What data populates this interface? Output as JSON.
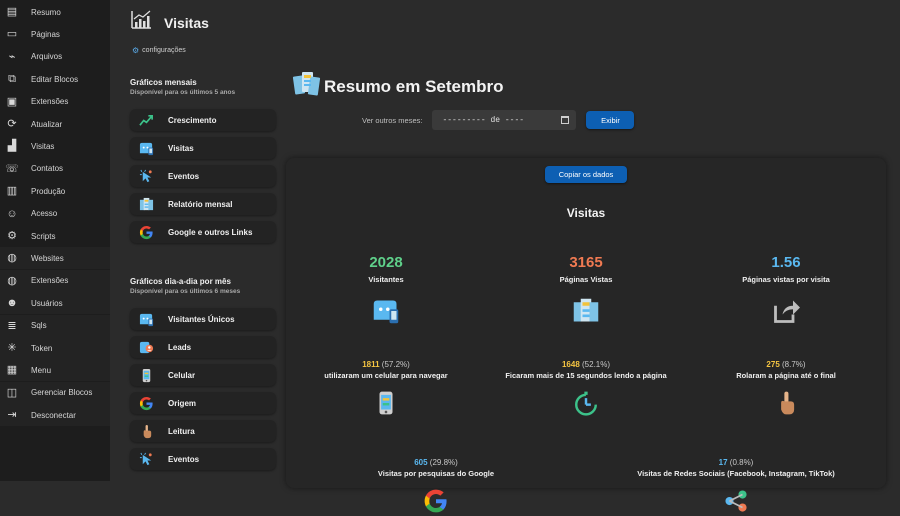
{
  "sidebar": {
    "items": [
      {
        "label": "Resumo",
        "icon": "newspaper-icon",
        "glyph": "▤"
      },
      {
        "label": "Páginas",
        "icon": "pages-icon",
        "glyph": "▭"
      },
      {
        "label": "Arquivos",
        "icon": "paperclip-icon",
        "glyph": "⌁"
      },
      {
        "label": "Editar Blocos",
        "icon": "blocks-icon",
        "glyph": "⧉"
      },
      {
        "label": "Extensões",
        "icon": "window-icon",
        "glyph": "▣"
      },
      {
        "label": "Atualizar",
        "icon": "update-icon",
        "glyph": "⟳"
      },
      {
        "label": "Visitas",
        "icon": "chart-icon",
        "glyph": "▟"
      },
      {
        "label": "Contatos",
        "icon": "contacts-icon",
        "glyph": "☏"
      },
      {
        "label": "Produção",
        "icon": "presentation-icon",
        "glyph": "▥"
      },
      {
        "label": "Acesso",
        "icon": "users-icon",
        "glyph": "☺"
      },
      {
        "label": "Scripts",
        "icon": "scripts-icon",
        "glyph": "⚙"
      },
      {
        "label": "Websites",
        "icon": "globe-icon",
        "glyph": "◍"
      },
      {
        "label": "Extensões",
        "icon": "globe-extensions-icon",
        "glyph": "◍"
      },
      {
        "label": "Usuários",
        "icon": "user-gear-icon",
        "glyph": "☻"
      },
      {
        "label": "Sqls",
        "icon": "database-icon",
        "glyph": "≣"
      },
      {
        "label": "Token",
        "icon": "network-icon",
        "glyph": "✳"
      },
      {
        "label": "Menu",
        "icon": "grid-icon",
        "glyph": "▦"
      },
      {
        "label": "Gerenciar Blocos",
        "icon": "manage-blocks-icon",
        "glyph": "◫"
      },
      {
        "label": "Desconectar",
        "icon": "logout-icon",
        "glyph": "⇥"
      }
    ]
  },
  "header": {
    "title": "Visitas",
    "config_label": "configurações"
  },
  "monthly": {
    "title": "Gráficos mensais",
    "subtitle": "Disponível para os últimos 5 anos",
    "buttons": [
      {
        "label": "Crescimento",
        "icon": "trend-icon"
      },
      {
        "label": "Visitas",
        "icon": "visitor-icon"
      },
      {
        "label": "Eventos",
        "icon": "cursor-events-icon"
      },
      {
        "label": "Relatório mensal",
        "icon": "report-icon"
      },
      {
        "label": "Google e outros Links",
        "icon": "google-icon"
      }
    ]
  },
  "daily": {
    "title": "Gráficos dia-a-dia por mês",
    "subtitle": "Disponível para os últimos 6 meses",
    "buttons": [
      {
        "label": "Visitantes Únicos",
        "icon": "visitor-icon"
      },
      {
        "label": "Leads",
        "icon": "leads-icon"
      },
      {
        "label": "Celular",
        "icon": "phone-icon"
      },
      {
        "label": "Origem",
        "icon": "google-icon"
      },
      {
        "label": "Leitura",
        "icon": "hand-pointer-icon"
      },
      {
        "label": "Eventos",
        "icon": "cursor-events-icon"
      }
    ]
  },
  "summary": {
    "title": "Resumo em Setembro",
    "month_label": "Ver outros meses:",
    "month_value": "--------- de ----",
    "show_button": "Exibir",
    "copy_button": "Copiar os dados",
    "card_title": "Visitas"
  },
  "stats": [
    {
      "value": "2028",
      "label": "Visitantes",
      "color": "#5fd08a",
      "icon": "visitor-icon"
    },
    {
      "value": "3165",
      "label": "Páginas Vistas",
      "color": "#f07a52",
      "icon": "report-icon"
    },
    {
      "value": "1.56",
      "label": "Páginas vistas por visita",
      "color": "#5ab8f0",
      "icon": "share-icon"
    }
  ],
  "details": [
    {
      "count": "1811",
      "pct": "(57.2%)",
      "label": "utilizaram um celular para navegar",
      "color": "#f5c542",
      "icon": "phone-icon"
    },
    {
      "count": "1648",
      "pct": "(52.1%)",
      "label": "Ficaram mais de 15 segundos lendo a página",
      "color": "#f5c542",
      "icon": "timer-icon"
    },
    {
      "count": "275",
      "pct": "(8.7%)",
      "label": "Rolaram a página até o final",
      "color": "#f5c542",
      "icon": "hand-pointer-icon"
    },
    {
      "count": "605",
      "pct": "(29.8%)",
      "label": "Visitas por pesquisas do Google",
      "color": "#5ab8f0",
      "icon": "google-icon"
    },
    {
      "count": "17",
      "pct": "(0.8%)",
      "label": "Visitas de Redes Sociais (Facebook, Instagram, TikTok)",
      "color": "#5ab8f0",
      "icon": "social-icon"
    }
  ]
}
